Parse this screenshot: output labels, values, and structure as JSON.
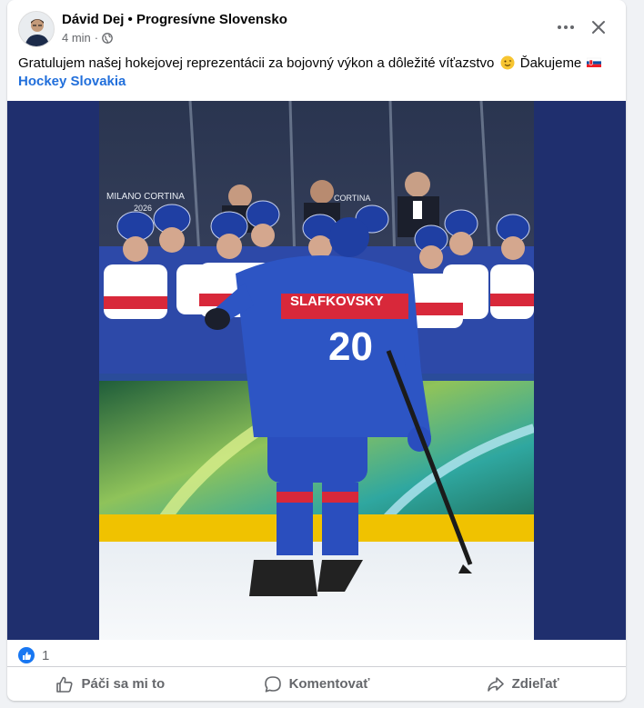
{
  "post": {
    "author_name": "Dávid Dej",
    "separator": "•",
    "page_name": "Progresívne Slovensko",
    "time": "4 min",
    "time_separator": "·",
    "audience_icon": "globe-icon",
    "text_main": "Gratulujem našej hokejovej reprezentácii za bojovný výkon a dôležité víťazstvo",
    "text_thanks": "Ďakujeme",
    "emoji_1": "smiling-face-emoji",
    "emoji_2": "slovakia-flag-emoji",
    "tag": "Hockey Slovakia"
  },
  "photo": {
    "jersey_name": "SLAFKOVSKY",
    "jersey_number": "20",
    "board_text_1": "MILANO CORTINA",
    "board_text_2": "2026",
    "board_text_3": "CORTINA"
  },
  "reactions": {
    "icon": "like-icon",
    "count": "1"
  },
  "actions": {
    "like_label": "Páči sa mi to",
    "comment_label": "Komentovať",
    "share_label": "Zdieľať"
  },
  "colors": {
    "like_blue": "#1877f2",
    "link_blue": "#216fdb",
    "media_bg": "#1f2f6e",
    "text_secondary": "#65676b"
  }
}
